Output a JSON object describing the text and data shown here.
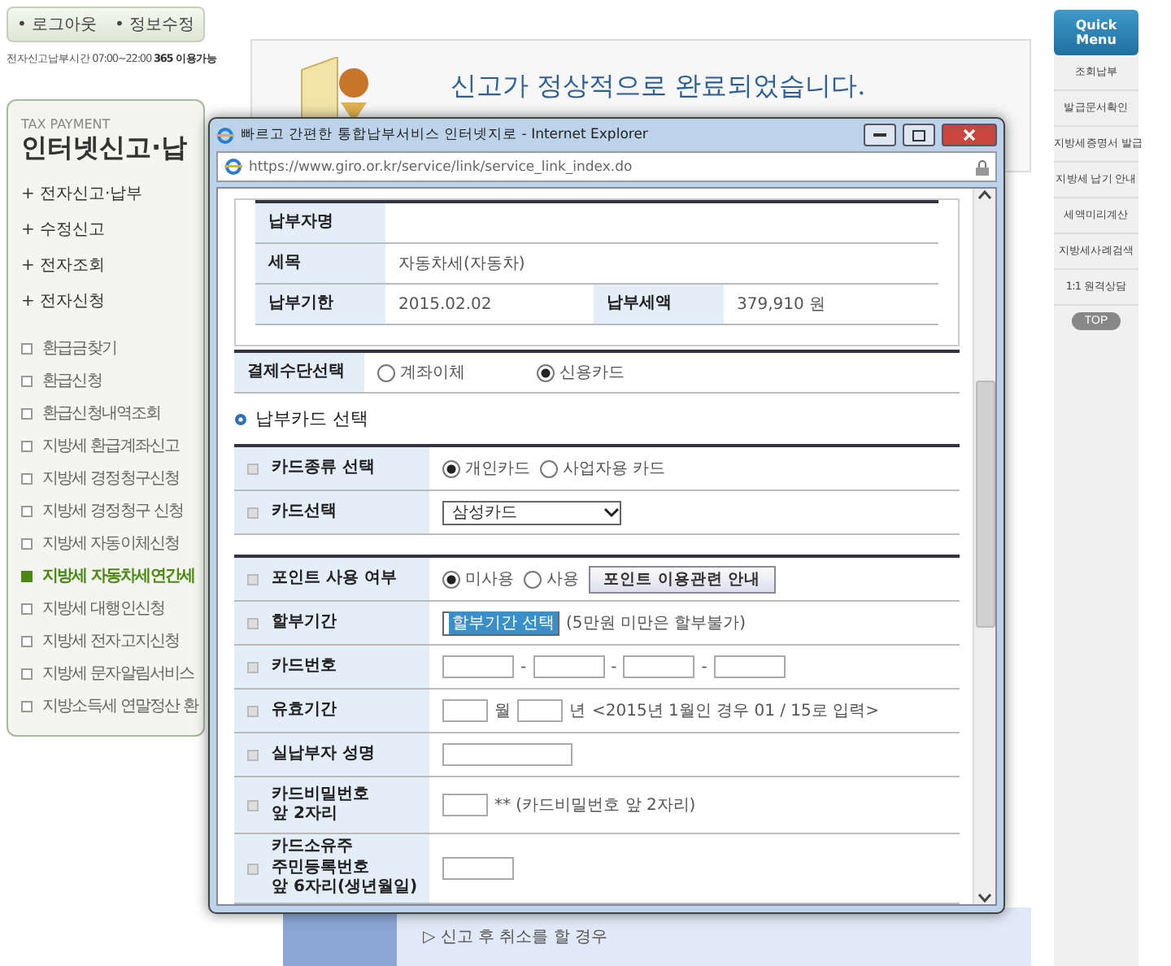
{
  "sidebar": {
    "buttons": [
      "• 로그아웃",
      "• 정보수정"
    ],
    "hours": "전자신고납부시간 07:00~22:00 **365 이용가능**",
    "panel": {
      "eyebrow": "TAX PAYMENT",
      "title": "인터넷신고·납",
      "menu": [
        "+ 전자신고·납부",
        "+ 수정신고",
        "+ 전자조회",
        "+ 전자신청"
      ],
      "items": [
        {
          "label": "환급금찾기",
          "selected": false
        },
        {
          "label": "환급신청",
          "selected": false
        },
        {
          "label": "환급신청내역조회",
          "selected": false
        },
        {
          "label": "지방세 환급계좌신고",
          "selected": false
        },
        {
          "label": "지방세 경정청구신청",
          "selected": false
        },
        {
          "label": "지방세 경정청구 신청",
          "selected": false
        },
        {
          "label": "지방세 자동이체신청",
          "selected": false
        },
        {
          "label": "지방세 자동차세연간세",
          "selected": true
        },
        {
          "label": "지방세 대행인신청",
          "selected": false
        },
        {
          "label": "지방세 전자고지신청",
          "selected": false
        },
        {
          "label": "지방세 문자알림서비스",
          "selected": false
        },
        {
          "label": "지방소득세 연말정산 환",
          "selected": false
        }
      ]
    }
  },
  "main": {
    "message": "신고가 정상적으로 완료되었습니다.",
    "bottom_link": "▷ 신고 후 취소를 할 경우"
  },
  "quick_menu": {
    "title": "Quick Menu",
    "items": [
      "조회납부",
      "발급문서확인",
      "지방세증명서 발급",
      "지방세 납기 안내",
      "세액미리계산",
      "지방세사례검색",
      "1:1 원격상담"
    ],
    "top": "TOP"
  },
  "popup": {
    "title": "빠르고 간편한 통합납부서비스 인터넷지로 - Internet Explorer",
    "url": "https://www.giro.or.kr/service/link/service_link_index.do",
    "summary": [
      {
        "label": "납부자명"
      },
      {
        "label": "세목",
        "value": "자동차세(자동차)"
      },
      {
        "label": "납부기한",
        "value": "2015.02.02",
        "label_2": "납부세액",
        "value_2": "379,910 원"
      }
    ],
    "payment_method": {
      "label": "결제수단선택",
      "options": [
        {
          "label": "계좌이체",
          "selected": false
        },
        {
          "label": "신용카드",
          "selected": true
        }
      ]
    },
    "section_title": "납부카드 선택",
    "groups": [
      [
        {
          "kind": "radio",
          "label": "카드종류 선택",
          "options": [
            {
              "label": "개인카드",
              "selected": true
            },
            {
              "label": "사업자용 카드",
              "selected": false
            }
          ]
        },
        {
          "kind": "select",
          "label": "카드선택",
          "value": "삼성카드",
          "focused": false
        }
      ],
      [
        {
          "kind": "radio",
          "label": "포인트 사용 여부",
          "options": [
            {
              "label": "미사용",
              "selected": true
            },
            {
              "label": "사용",
              "selected": false
            }
          ],
          "button": "포인트 이용관련 안내"
        },
        {
          "kind": "select",
          "label": "할부기간",
          "value": "할부기간 선택",
          "focused": true,
          "note": "(5만원 미만은 할부불가)"
        },
        {
          "kind": "card_number",
          "label": "카드번호",
          "separators": [
            "-",
            "-",
            "-"
          ]
        },
        {
          "kind": "expiry",
          "label": "유효기간",
          "units": [
            "월",
            "년"
          ],
          "note": "<2015년 1월인 경우 01 / 15로 입력>"
        },
        {
          "kind": "name",
          "label": "실납부자 성명"
        },
        {
          "kind": "pin",
          "label": "카드비밀번호\n앞 2자리",
          "note": "** (카드비밀번호 앞 2자리)"
        },
        {
          "kind": "id",
          "label": "카드소유주\n주민등록번호\n앞 6자리(생년월일)"
        }
      ]
    ]
  }
}
